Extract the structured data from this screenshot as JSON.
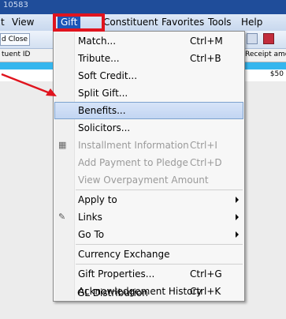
{
  "window": {
    "title": "10583"
  },
  "menubar": [
    "t",
    "View",
    "Gift",
    "Constituent",
    "Favorites",
    "Tools",
    "Help"
  ],
  "toolbar": {
    "close_label": "d Close"
  },
  "columns": {
    "left": "tuent ID",
    "right": "Receipt amou"
  },
  "row": {
    "amount": "$50"
  },
  "gift_menu": [
    {
      "label": "Match...",
      "shortcut": "Ctrl+M",
      "enabled": true
    },
    {
      "label": "Tribute...",
      "shortcut": "Ctrl+B",
      "enabled": true
    },
    {
      "label": "Soft Credit...",
      "shortcut": "",
      "enabled": true
    },
    {
      "label": "Split Gift...",
      "shortcut": "",
      "enabled": true
    },
    {
      "label": "Benefits...",
      "shortcut": "",
      "enabled": true,
      "highlighted": true
    },
    {
      "label": "Solicitors...",
      "shortcut": "",
      "enabled": true
    },
    {
      "label": "Installment Information",
      "shortcut": "Ctrl+I",
      "enabled": false
    },
    {
      "label": "Add Payment to Pledge",
      "shortcut": "Ctrl+D",
      "enabled": false
    },
    {
      "label": "View Overpayment Amount",
      "shortcut": "",
      "enabled": false
    },
    {
      "label": "Apply to",
      "shortcut": "",
      "enabled": true,
      "submenu": true
    },
    {
      "label": "Links",
      "shortcut": "",
      "enabled": true,
      "submenu": true
    },
    {
      "label": "Go To",
      "shortcut": "",
      "enabled": true,
      "submenu": true
    },
    {
      "label": "Currency Exchange",
      "shortcut": "",
      "enabled": true
    },
    {
      "label": "Gift Properties...",
      "shortcut": "Ctrl+G",
      "enabled": true
    },
    {
      "label": "Acknowledgement History",
      "shortcut": "Ctrl+K",
      "enabled": true
    },
    {
      "label": "GL Distribution",
      "shortcut": "",
      "enabled": true
    }
  ],
  "colors": {
    "accent": "#1c56b8",
    "highlight_box": "#e0141e",
    "row_band": "#35b6ee"
  }
}
